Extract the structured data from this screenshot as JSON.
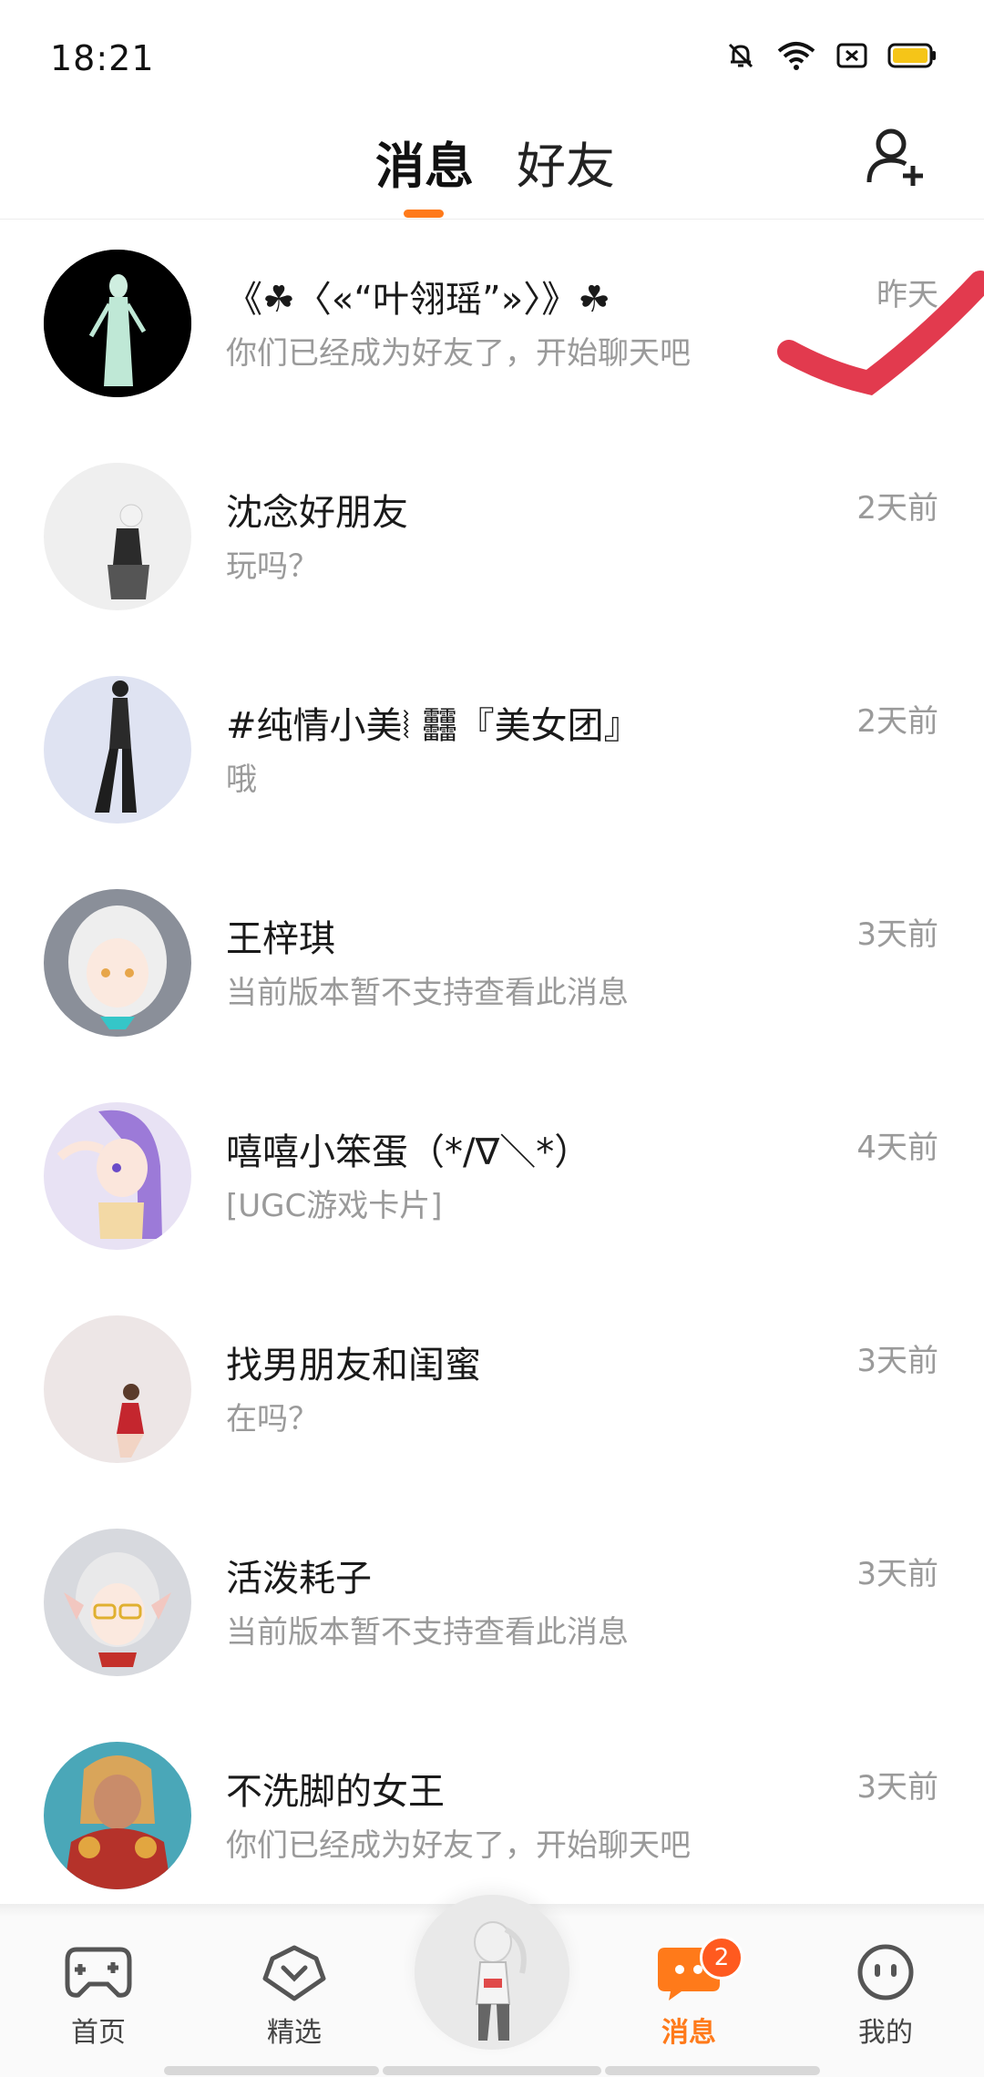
{
  "status_bar": {
    "time": "18:21",
    "icons": [
      "mute-bell-icon",
      "wifi-icon",
      "sim-icon",
      "battery-icon"
    ],
    "battery_color": "#f5c518"
  },
  "header": {
    "tabs": [
      {
        "label": "消息",
        "active": true
      },
      {
        "label": "好友",
        "active": false
      }
    ],
    "add_friend_icon": "add-friend-icon",
    "accent": "#ff7a1a"
  },
  "conversations": [
    {
      "name": "《☘〈«“叶翎瑶”»〉》☘",
      "preview": "你们已经成为好友了，开始聊天吧",
      "time": "昨天",
      "avatar_bg": "#000000"
    },
    {
      "name": "沈念好朋友",
      "preview": "玩吗？",
      "time": "2天前",
      "avatar_bg": "#efefef"
    },
    {
      "name": "#纯情小美⦚ 䨻『美女团』",
      "preview": "哦",
      "time": "2天前",
      "avatar_bg": "#dfe3f2"
    },
    {
      "name": "王梓琪",
      "preview": "当前版本暂不支持查看此消息",
      "time": "3天前",
      "avatar_bg": "#8a8f99"
    },
    {
      "name": "嘻嘻小笨蛋（*/∇＼*）",
      "preview": "[UGC游戏卡片]",
      "time": "4天前",
      "avatar_bg": "#e8e2f4"
    },
    {
      "name": "找男朋友和闺蜜",
      "preview": "在吗？",
      "time": "3天前",
      "avatar_bg": "#ede6e6"
    },
    {
      "name": "活泼耗子",
      "preview": "当前版本暂不支持查看此消息",
      "time": "3天前",
      "avatar_bg": "#d7d9de"
    },
    {
      "name": "不洗脚的女王",
      "preview": "你们已经成为好友了，开始聊天吧",
      "time": "3天前",
      "avatar_bg": "#4aa7b8"
    }
  ],
  "bottom_nav": {
    "items": [
      {
        "label": "首页",
        "icon": "gamepad-icon"
      },
      {
        "label": "精选",
        "icon": "heart-badge-icon"
      },
      {
        "label": "消息",
        "icon": "chat-bubble-icon",
        "active": true,
        "badge": "2"
      },
      {
        "label": "我的",
        "icon": "face-icon"
      }
    ],
    "center_icon": "character-avatar-icon"
  }
}
